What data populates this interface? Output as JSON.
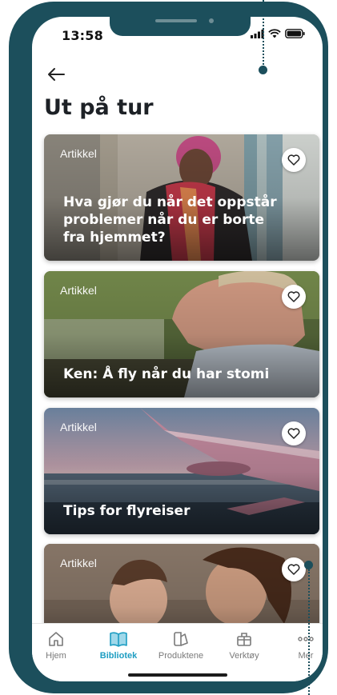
{
  "status_bar": {
    "time": "13:58"
  },
  "page": {
    "title": "Ut på tur"
  },
  "cards": [
    {
      "type": "Artikkel",
      "title": "Hva gjør du når det oppstår problemer når du er borte fra hjemmet?",
      "favorite": false
    },
    {
      "type": "Artikkel",
      "title": "Ken: Å fly når du har stomi",
      "favorite": false
    },
    {
      "type": "Artikkel",
      "title": "Tips for flyreiser",
      "favorite": false
    },
    {
      "type": "Artikkel",
      "title": "",
      "favorite": false
    }
  ],
  "tabbar": {
    "items": [
      {
        "label": "Hjem",
        "icon": "home-icon",
        "active": false
      },
      {
        "label": "Bibliotek",
        "icon": "book-icon",
        "active": true
      },
      {
        "label": "Produktene",
        "icon": "products-icon",
        "active": false
      },
      {
        "label": "Verktøy",
        "icon": "toolbox-icon",
        "active": false
      },
      {
        "label": "Mer",
        "icon": "more-icon",
        "active": false
      }
    ]
  },
  "colors": {
    "frame": "#1c4f5c",
    "accent": "#1d9dc2",
    "title": "#1d2126"
  }
}
